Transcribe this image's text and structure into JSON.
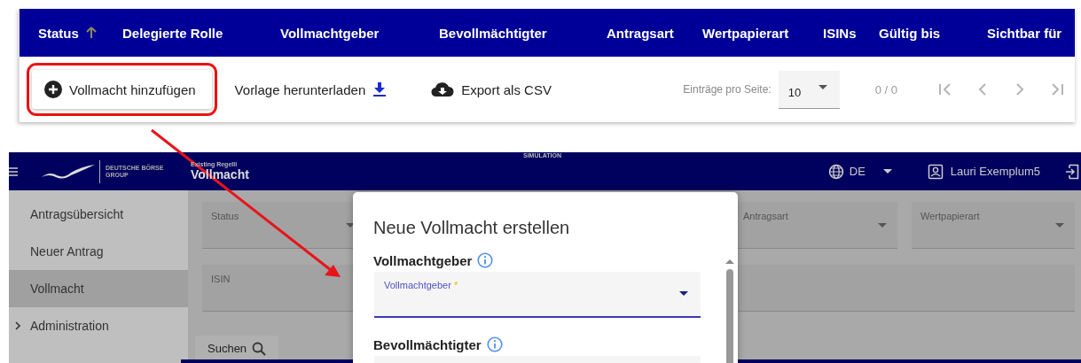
{
  "table_header": {
    "columns": [
      {
        "label": "Status",
        "sorted": true
      },
      {
        "label": "Delegierte Rolle",
        "sorted": false
      },
      {
        "label": "Vollmachtgeber",
        "sorted": false
      },
      {
        "label": "Bevollmächtigter",
        "sorted": false
      },
      {
        "label": "Antragsart",
        "sorted": false
      },
      {
        "label": "Wertpapierart",
        "sorted": false
      },
      {
        "label": "ISINs",
        "sorted": false
      },
      {
        "label": "Gültig bis",
        "sorted": false
      },
      {
        "label": "Sichtbar für",
        "sorted": false
      }
    ]
  },
  "toolbar": {
    "buttons": [
      {
        "label": "Vollmacht hinzufügen",
        "kind": "add",
        "highlighted": true
      },
      {
        "label": "Vorlage herunterladen",
        "kind": "download",
        "highlighted": false
      },
      {
        "label": "Export als CSV",
        "kind": "export",
        "highlighted": false
      }
    ]
  },
  "paginator": {
    "label": "Einträge pro Seite:",
    "page_size": "10",
    "range": "0 / 0",
    "buttons": [
      {
        "kind": "first",
        "disabled": true
      },
      {
        "kind": "prev",
        "disabled": true
      },
      {
        "kind": "next",
        "disabled": true
      },
      {
        "kind": "last",
        "disabled": true
      }
    ]
  },
  "app": {
    "header": {
      "logo_line_1": "DEUTSCHE BÖRSE",
      "logo_line_2": "GROUP",
      "subtitle": "Existing Regelli",
      "title": "Vollmacht",
      "environment": "SIMULATION",
      "language": "DE",
      "user": "Lauri Exemplum5"
    },
    "sidebar": {
      "items": [
        {
          "label": "Antragsübersicht",
          "selected": false
        },
        {
          "label": "Neuer Antrag",
          "selected": false
        },
        {
          "label": "Vollmacht",
          "selected": true
        },
        {
          "label": "Administration",
          "selected": false,
          "expanded": false
        }
      ]
    },
    "filters": [
      {
        "label": "Status",
        "kind": "select"
      },
      {
        "label": "Antragsart",
        "kind": "select"
      },
      {
        "label": "Wertpapierart",
        "kind": "select"
      },
      {
        "label": "ISIN",
        "kind": "text"
      }
    ],
    "search_button": "Suchen",
    "dialog": {
      "title": "Neue Vollmacht erstellen",
      "sections": [
        {
          "heading": "Vollmachtgeber",
          "field_label": "Vollmachtgeber",
          "required_mark": "*",
          "focused": true
        },
        {
          "heading": "Bevollmächtigter",
          "focused": false
        }
      ]
    }
  }
}
